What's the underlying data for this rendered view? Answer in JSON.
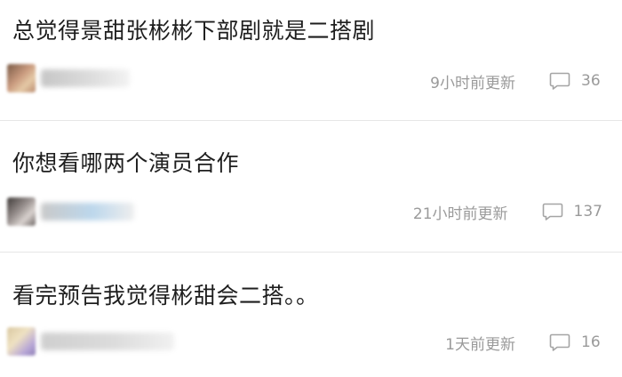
{
  "posts": [
    {
      "title": "总觉得景甜张彬彬下部剧就是二搭剧",
      "time": "9小时前更新",
      "comments": "36",
      "icon": "comment-icon"
    },
    {
      "title": "你想看哪两个演员合作",
      "time": "21小时前更新",
      "comments": "137",
      "icon": "comment-icon"
    },
    {
      "title": "看完预告我觉得彬甜会二搭。。",
      "time": "1天前更新",
      "comments": "16",
      "icon": "comment-icon"
    }
  ],
  "colors": {
    "title": "#1e1e1e",
    "meta": "#9a9a9a",
    "divider": "#e6e6e6",
    "background": "#ffffff"
  }
}
